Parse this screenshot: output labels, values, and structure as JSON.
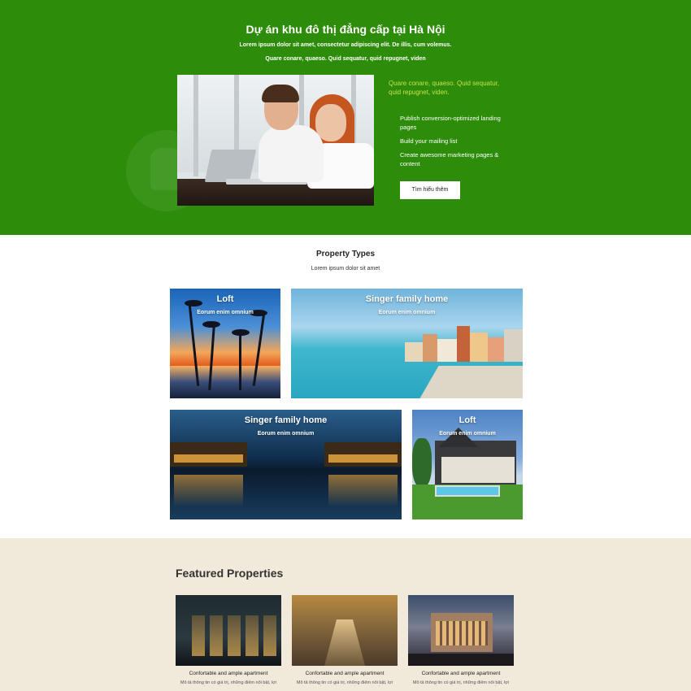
{
  "hero": {
    "title": "Dự án khu đô thị đẳng cấp tại Hà Nội",
    "subtitle_line1": "Lorem ipsum dolor sit amet, consectetur adipiscing elit. De illis, cum volemus.",
    "subtitle_line2": "Quare conare, quaeso. Quid sequatur, quid repugnet, viden",
    "quote": "Quare conare, quaeso. Quid sequatur, quid repugnet, viden.",
    "list": [
      "Publish conversion-optimized landing pages",
      "Build your mailing list",
      "Create awesome marketing pages & content"
    ],
    "button_label": "Tìm hiểu thêm",
    "background_color": "#2d8c09",
    "quote_color": "#c6e24b"
  },
  "property_types": {
    "title": "Property Types",
    "subtitle": "Lorem ipsum dolor sit amet",
    "cards": [
      {
        "title": "Loft",
        "subtitle": "Eorum enim omnium"
      },
      {
        "title": "Singer family home",
        "subtitle": "Eorum enim omnium"
      },
      {
        "title": "Singer family home",
        "subtitle": "Eorum enim omnium"
      },
      {
        "title": "Loft",
        "subtitle": "Eorum enim omnium"
      }
    ]
  },
  "featured": {
    "title": "Featured Properties",
    "items": [
      {
        "name": "Confortable and ample apartment",
        "desc": "Mô tả thông tin có giá trị, những điểm nổi bật, lợi ích thiết thực về sản phẩm dịch vụ của"
      },
      {
        "name": "Confortable and ample apartment",
        "desc": "Mô tả thông tin có giá trị, những điểm nổi bật, lợi ích thiết thực về sản phẩm dịch vụ của"
      },
      {
        "name": "Confortable and ample apartment",
        "desc": "Mô tả thông tin có giá trị, những điểm nổi bật, lợi ích thiết thực về sản phẩm dịch vụ của"
      }
    ]
  }
}
